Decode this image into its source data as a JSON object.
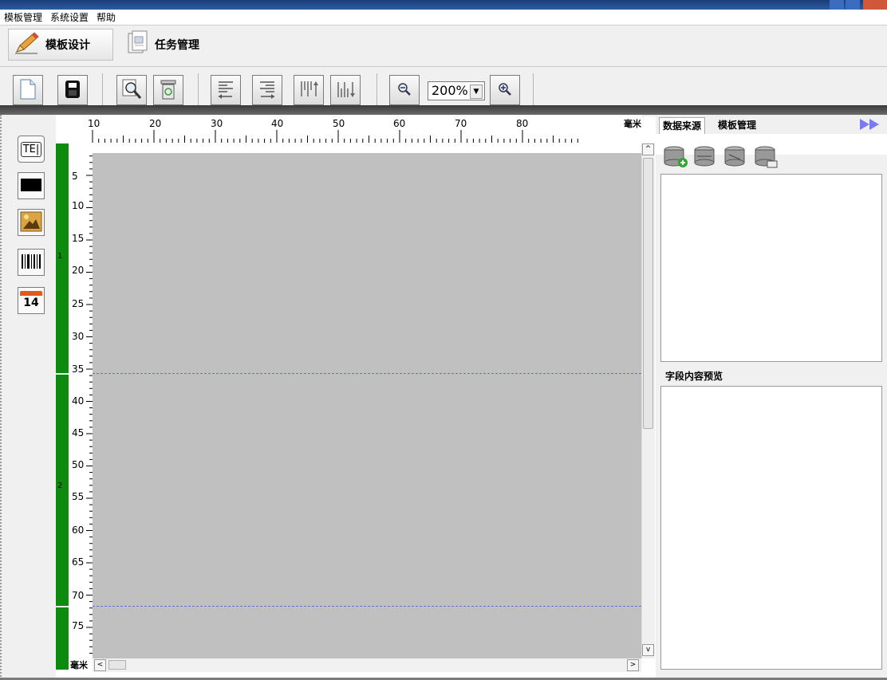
{
  "menu": [
    "模板管理",
    "系统设置",
    "帮助"
  ],
  "main_tabs": [
    {
      "label": "模板设计",
      "icon": "pencil-icon"
    },
    {
      "label": "任务管理",
      "icon": "document-icon"
    }
  ],
  "toolbar": {
    "new_icon": "new-file-icon",
    "save_icon": "save-icon",
    "preview_icon": "print-preview-icon",
    "delete_icon": "delete-icon",
    "zoom_value": "200%"
  },
  "ruler": {
    "unit": "毫米",
    "h_labels": [
      "10",
      "20",
      "30",
      "40",
      "50",
      "60",
      "70",
      "80"
    ],
    "v_labels": [
      "5",
      "10",
      "15",
      "20",
      "25",
      "30",
      "35",
      "40",
      "45",
      "50",
      "55",
      "60",
      "65",
      "70",
      "75"
    ],
    "pages": [
      "1",
      "2"
    ]
  },
  "palette": [
    {
      "name": "text-tool",
      "label": "TE|"
    },
    {
      "name": "rectangle-tool",
      "label": ""
    },
    {
      "name": "image-tool",
      "label": ""
    },
    {
      "name": "barcode-tool",
      "label": ""
    },
    {
      "name": "date-tool",
      "label": "14"
    }
  ],
  "right_panel": {
    "tabs": [
      "数据来源",
      "模板管理"
    ],
    "preview_title": "字段内容预览"
  },
  "colors": {
    "page_bar": "#0e8a0e",
    "canvas": "#c0c0c0",
    "page_break": "#6c6cd8"
  }
}
